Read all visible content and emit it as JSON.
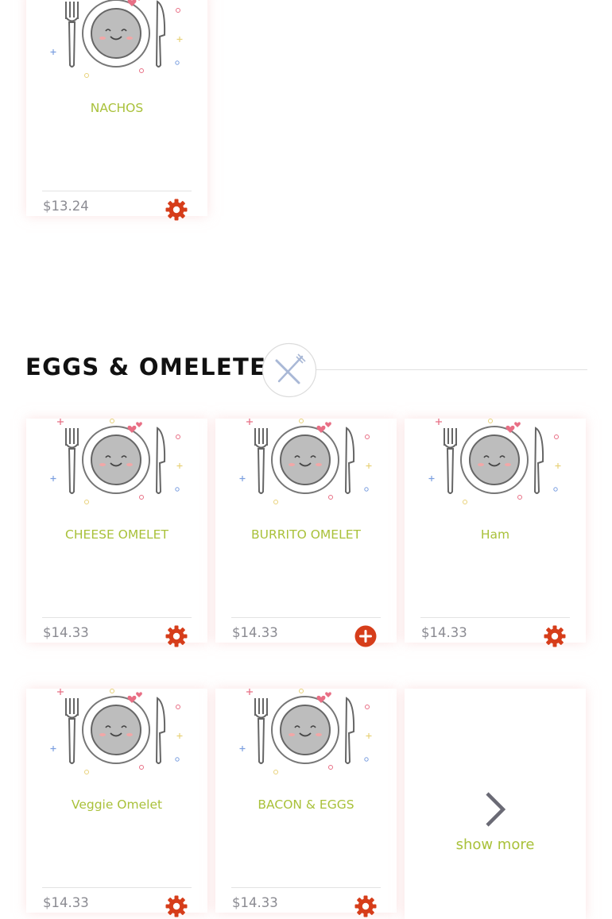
{
  "top_items": [
    {
      "name": "NACHOS",
      "price": "$13.24",
      "action_icon": "gear-icon"
    }
  ],
  "section": {
    "title": "EGGS & OMELETES",
    "icon": "fork-knife-icon",
    "items": [
      {
        "name": "CHEESE OMELET",
        "price": "$14.33",
        "action_icon": "gear-icon"
      },
      {
        "name": "BURRITO OMELET",
        "price": "$14.33",
        "action_icon": "plus-icon"
      },
      {
        "name": "Ham",
        "price": "$14.33",
        "action_icon": "gear-icon"
      },
      {
        "name": "Veggie Omelet",
        "price": "$14.33",
        "action_icon": "gear-icon"
      },
      {
        "name": "BACON & EGGS",
        "price": "$14.33",
        "action_icon": "gear-icon"
      }
    ],
    "show_more_label": "show more"
  },
  "colors": {
    "accent": "#a9c13a",
    "action": "#d63d1a",
    "price": "#8b8b92",
    "card_shadow": "#f8cdcd"
  }
}
